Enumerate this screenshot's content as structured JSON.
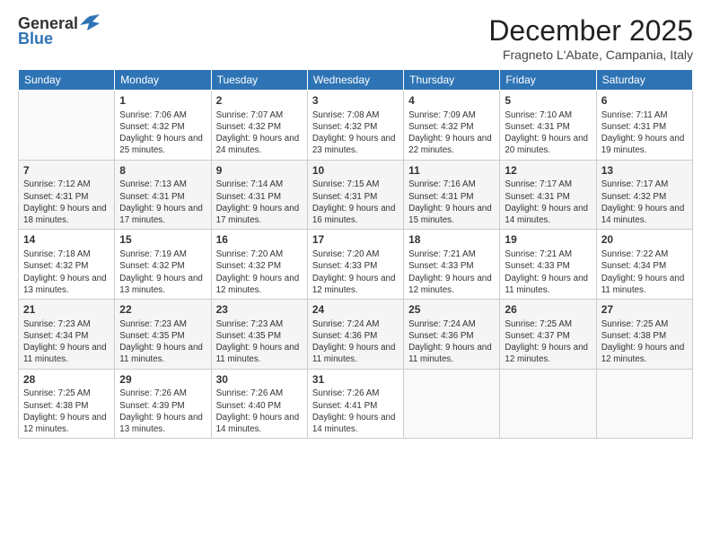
{
  "logo": {
    "general": "General",
    "blue": "Blue"
  },
  "title": "December 2025",
  "location": "Fragneto L'Abate, Campania, Italy",
  "days_of_week": [
    "Sunday",
    "Monday",
    "Tuesday",
    "Wednesday",
    "Thursday",
    "Friday",
    "Saturday"
  ],
  "weeks": [
    [
      {
        "day": "",
        "info": ""
      },
      {
        "day": "1",
        "info": "Sunrise: 7:06 AM\nSunset: 4:32 PM\nDaylight: 9 hours\nand 25 minutes."
      },
      {
        "day": "2",
        "info": "Sunrise: 7:07 AM\nSunset: 4:32 PM\nDaylight: 9 hours\nand 24 minutes."
      },
      {
        "day": "3",
        "info": "Sunrise: 7:08 AM\nSunset: 4:32 PM\nDaylight: 9 hours\nand 23 minutes."
      },
      {
        "day": "4",
        "info": "Sunrise: 7:09 AM\nSunset: 4:32 PM\nDaylight: 9 hours\nand 22 minutes."
      },
      {
        "day": "5",
        "info": "Sunrise: 7:10 AM\nSunset: 4:31 PM\nDaylight: 9 hours\nand 20 minutes."
      },
      {
        "day": "6",
        "info": "Sunrise: 7:11 AM\nSunset: 4:31 PM\nDaylight: 9 hours\nand 19 minutes."
      }
    ],
    [
      {
        "day": "7",
        "info": "Sunrise: 7:12 AM\nSunset: 4:31 PM\nDaylight: 9 hours\nand 18 minutes."
      },
      {
        "day": "8",
        "info": "Sunrise: 7:13 AM\nSunset: 4:31 PM\nDaylight: 9 hours\nand 17 minutes."
      },
      {
        "day": "9",
        "info": "Sunrise: 7:14 AM\nSunset: 4:31 PM\nDaylight: 9 hours\nand 17 minutes."
      },
      {
        "day": "10",
        "info": "Sunrise: 7:15 AM\nSunset: 4:31 PM\nDaylight: 9 hours\nand 16 minutes."
      },
      {
        "day": "11",
        "info": "Sunrise: 7:16 AM\nSunset: 4:31 PM\nDaylight: 9 hours\nand 15 minutes."
      },
      {
        "day": "12",
        "info": "Sunrise: 7:17 AM\nSunset: 4:31 PM\nDaylight: 9 hours\nand 14 minutes."
      },
      {
        "day": "13",
        "info": "Sunrise: 7:17 AM\nSunset: 4:32 PM\nDaylight: 9 hours\nand 14 minutes."
      }
    ],
    [
      {
        "day": "14",
        "info": "Sunrise: 7:18 AM\nSunset: 4:32 PM\nDaylight: 9 hours\nand 13 minutes."
      },
      {
        "day": "15",
        "info": "Sunrise: 7:19 AM\nSunset: 4:32 PM\nDaylight: 9 hours\nand 13 minutes."
      },
      {
        "day": "16",
        "info": "Sunrise: 7:20 AM\nSunset: 4:32 PM\nDaylight: 9 hours\nand 12 minutes."
      },
      {
        "day": "17",
        "info": "Sunrise: 7:20 AM\nSunset: 4:33 PM\nDaylight: 9 hours\nand 12 minutes."
      },
      {
        "day": "18",
        "info": "Sunrise: 7:21 AM\nSunset: 4:33 PM\nDaylight: 9 hours\nand 12 minutes."
      },
      {
        "day": "19",
        "info": "Sunrise: 7:21 AM\nSunset: 4:33 PM\nDaylight: 9 hours\nand 11 minutes."
      },
      {
        "day": "20",
        "info": "Sunrise: 7:22 AM\nSunset: 4:34 PM\nDaylight: 9 hours\nand 11 minutes."
      }
    ],
    [
      {
        "day": "21",
        "info": "Sunrise: 7:23 AM\nSunset: 4:34 PM\nDaylight: 9 hours\nand 11 minutes."
      },
      {
        "day": "22",
        "info": "Sunrise: 7:23 AM\nSunset: 4:35 PM\nDaylight: 9 hours\nand 11 minutes."
      },
      {
        "day": "23",
        "info": "Sunrise: 7:23 AM\nSunset: 4:35 PM\nDaylight: 9 hours\nand 11 minutes."
      },
      {
        "day": "24",
        "info": "Sunrise: 7:24 AM\nSunset: 4:36 PM\nDaylight: 9 hours\nand 11 minutes."
      },
      {
        "day": "25",
        "info": "Sunrise: 7:24 AM\nSunset: 4:36 PM\nDaylight: 9 hours\nand 11 minutes."
      },
      {
        "day": "26",
        "info": "Sunrise: 7:25 AM\nSunset: 4:37 PM\nDaylight: 9 hours\nand 12 minutes."
      },
      {
        "day": "27",
        "info": "Sunrise: 7:25 AM\nSunset: 4:38 PM\nDaylight: 9 hours\nand 12 minutes."
      }
    ],
    [
      {
        "day": "28",
        "info": "Sunrise: 7:25 AM\nSunset: 4:38 PM\nDaylight: 9 hours\nand 12 minutes."
      },
      {
        "day": "29",
        "info": "Sunrise: 7:26 AM\nSunset: 4:39 PM\nDaylight: 9 hours\nand 13 minutes."
      },
      {
        "day": "30",
        "info": "Sunrise: 7:26 AM\nSunset: 4:40 PM\nDaylight: 9 hours\nand 14 minutes."
      },
      {
        "day": "31",
        "info": "Sunrise: 7:26 AM\nSunset: 4:41 PM\nDaylight: 9 hours\nand 14 minutes."
      },
      {
        "day": "",
        "info": ""
      },
      {
        "day": "",
        "info": ""
      },
      {
        "day": "",
        "info": ""
      }
    ]
  ]
}
